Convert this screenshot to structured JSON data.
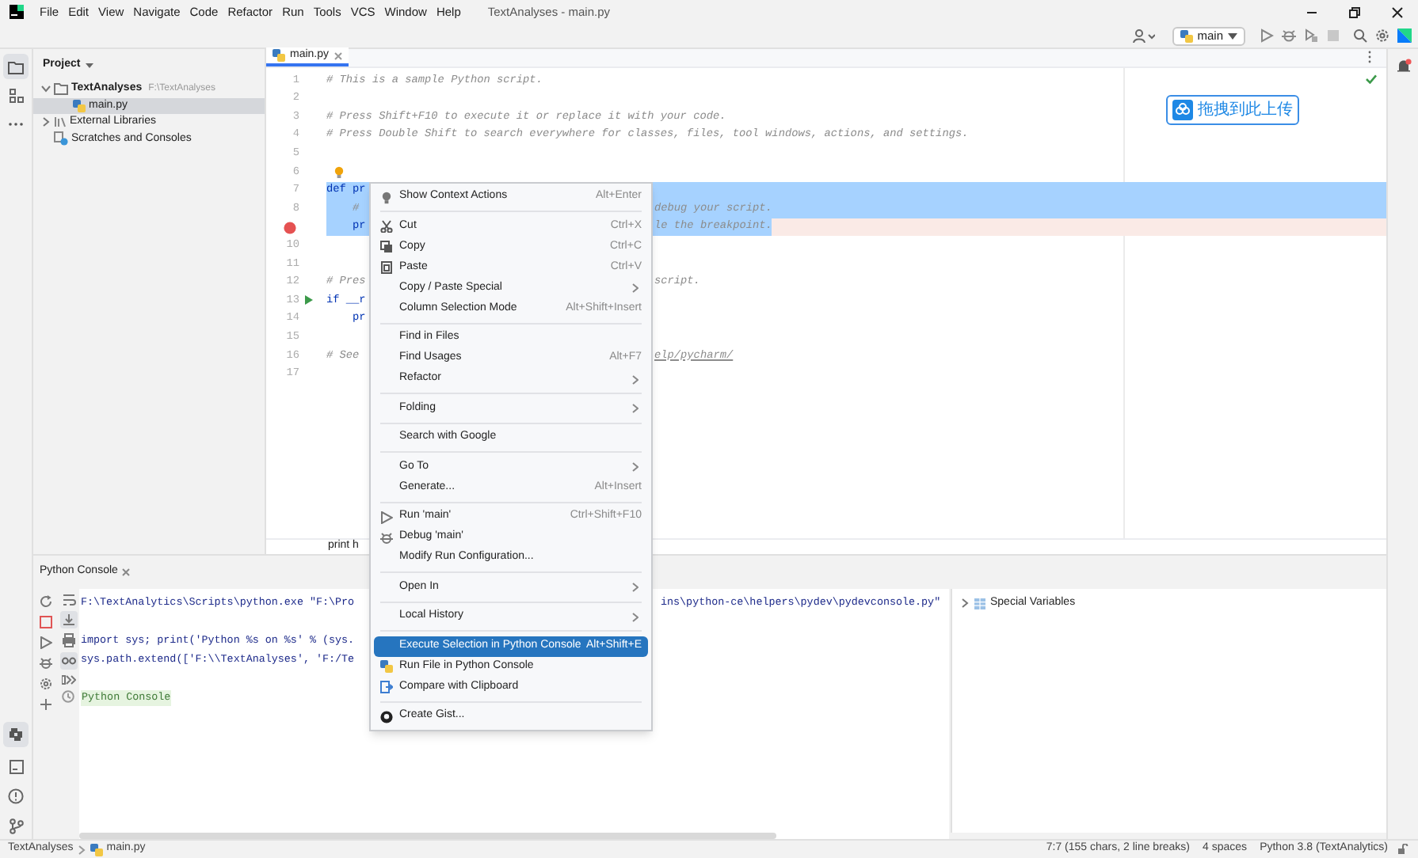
{
  "window": {
    "title": "TextAnalyses - main.py"
  },
  "menubar": [
    "File",
    "Edit",
    "View",
    "Navigate",
    "Code",
    "Refactor",
    "Run",
    "Tools",
    "VCS",
    "Window",
    "Help"
  ],
  "toolbar": {
    "run_config": "main"
  },
  "project": {
    "title": "Project",
    "tree": [
      {
        "label": "TextAnalyses",
        "path": "F:\\TextAnalyses",
        "kind": "folder",
        "expanded": true,
        "selected": false,
        "children": [
          {
            "label": "main.py",
            "kind": "file",
            "selected": true
          }
        ]
      },
      {
        "label": "External Libraries",
        "kind": "library",
        "expanded": false,
        "selected": false
      },
      {
        "label": "Scratches and Consoles",
        "kind": "scratches",
        "selected": false
      }
    ]
  },
  "editor": {
    "tabs": [
      {
        "label": "main.py",
        "selected": true
      }
    ],
    "lines": [
      {
        "number": "1",
        "left": {
          "text": "# This is a sample Python script.",
          "kind": "comment"
        },
        "selected": false
      },
      {
        "number": "2",
        "selected": false
      },
      {
        "number": "3",
        "left": {
          "text": "# Press Shift+F10 to execute it or replace it with your code.",
          "kind": "comment"
        },
        "selected": false
      },
      {
        "number": "4",
        "left": {
          "text": "# Press Double Shift to search everywhere for classes, files, tool windows, actions, and settings.",
          "kind": "comment"
        },
        "selected": false
      },
      {
        "number": "5",
        "selected": false
      },
      {
        "number": "6",
        "kind": "bulb",
        "selected": false
      },
      {
        "number": "7",
        "left": {
          "text": "def pr",
          "kind": "code"
        },
        "selected": true
      },
      {
        "number": "8",
        "left": {
          "text": "    #",
          "kind": "comment"
        },
        "right": {
          "text": "debug your script.",
          "kind": "comment"
        },
        "selected": true
      },
      {
        "kind": "breakpoint",
        "left": {
          "text": "    pr",
          "kind": "code"
        },
        "right": {
          "text": "le the breakpoint.",
          "kind": "comment"
        },
        "selected": true
      },
      {
        "number": "10",
        "selected": false
      },
      {
        "number": "11",
        "selected": false
      },
      {
        "number": "12",
        "left": {
          "text": "# Pres",
          "kind": "comment"
        },
        "right": {
          "text": "script.",
          "kind": "comment"
        },
        "selected": false
      },
      {
        "number": "13",
        "kind": "run",
        "left": {
          "text": "if __r",
          "kind": "code"
        },
        "selected": false
      },
      {
        "number": "14",
        "left": {
          "text": "    pr",
          "kind": "code"
        },
        "selected": false
      },
      {
        "number": "15",
        "selected": false
      },
      {
        "number": "16",
        "left": {
          "text": "# See",
          "kind": "comment"
        },
        "right": {
          "text": "elp/pycharm/",
          "kind": "link"
        },
        "selected": false
      },
      {
        "number": "17",
        "selected": false
      }
    ],
    "breadcrumb": "print h"
  },
  "upload_badge": {
    "label": "拖拽到此上传"
  },
  "console": {
    "tab": "Python Console",
    "lines": [
      {
        "left": "F:\\TextAnalytics\\Scripts\\python.exe \"F:\\Pro",
        "right": "ins\\python-ce\\helpers\\pydev\\pydevconsole.py\"",
        "kind": "output"
      },
      {
        "kind": "blank"
      },
      {
        "left": "import sys; print('Python %s on %s' % (sys.",
        "kind": "output"
      },
      {
        "left": "sys.path.extend(['F:\\\\TextAnalyses', 'F:/Te",
        "kind": "output"
      },
      {
        "kind": "blank"
      },
      {
        "left": "Python Console",
        "kind": "prompt"
      }
    ],
    "variables": [
      {
        "label": "Special Variables",
        "expanded": false
      }
    ]
  },
  "context_menu": {
    "items": [
      {
        "kind": "item",
        "label": "Show Context Actions",
        "shortcut": "Alt+Enter",
        "selected": false
      },
      {
        "kind": "separator"
      },
      {
        "kind": "item",
        "label": "Cut",
        "shortcut": "Ctrl+X",
        "selected": false
      },
      {
        "kind": "item",
        "label": "Copy",
        "shortcut": "Ctrl+C",
        "selected": false
      },
      {
        "kind": "item",
        "label": "Paste",
        "shortcut": "Ctrl+V",
        "selected": false
      },
      {
        "kind": "item",
        "label": "Copy / Paste Special",
        "submenu": true,
        "selected": false
      },
      {
        "kind": "item",
        "label": "Column Selection Mode",
        "shortcut": "Alt+Shift+Insert",
        "selected": false
      },
      {
        "kind": "separator"
      },
      {
        "kind": "item",
        "label": "Find in Files",
        "selected": false
      },
      {
        "kind": "item",
        "label": "Find Usages",
        "shortcut": "Alt+F7",
        "selected": false
      },
      {
        "kind": "item",
        "label": "Refactor",
        "submenu": true,
        "selected": false
      },
      {
        "kind": "separator"
      },
      {
        "kind": "item",
        "label": "Folding",
        "submenu": true,
        "selected": false
      },
      {
        "kind": "separator"
      },
      {
        "kind": "item",
        "label": "Search with Google",
        "selected": false
      },
      {
        "kind": "separator"
      },
      {
        "kind": "item",
        "label": "Go To",
        "submenu": true,
        "selected": false
      },
      {
        "kind": "item",
        "label": "Generate...",
        "shortcut": "Alt+Insert",
        "selected": false
      },
      {
        "kind": "separator"
      },
      {
        "kind": "item",
        "label": "Run 'main'",
        "shortcut": "Ctrl+Shift+F10",
        "selected": false
      },
      {
        "kind": "item",
        "label": "Debug 'main'",
        "selected": false
      },
      {
        "kind": "item",
        "label": "Modify Run Configuration...",
        "selected": false
      },
      {
        "kind": "separator"
      },
      {
        "kind": "item",
        "label": "Open In",
        "submenu": true,
        "selected": false
      },
      {
        "kind": "separator"
      },
      {
        "kind": "item",
        "label": "Local History",
        "submenu": true,
        "selected": false
      },
      {
        "kind": "separator"
      },
      {
        "kind": "item",
        "label": "Execute Selection in Python Console",
        "shortcut": "Alt+Shift+E",
        "selected": true
      },
      {
        "kind": "item",
        "label": "Run File in Python Console",
        "selected": false
      },
      {
        "kind": "item",
        "label": "Compare with Clipboard",
        "selected": false
      },
      {
        "kind": "separator"
      },
      {
        "kind": "item",
        "label": "Create Gist...",
        "selected": false
      }
    ]
  },
  "status_bar": {
    "breadcrumbs": [
      "TextAnalyses",
      "main.py"
    ],
    "position": "7:7 (155 chars, 2 line breaks)",
    "indent": "4 spaces",
    "interpreter": "Python 3.8 (TextAnalytics)"
  }
}
